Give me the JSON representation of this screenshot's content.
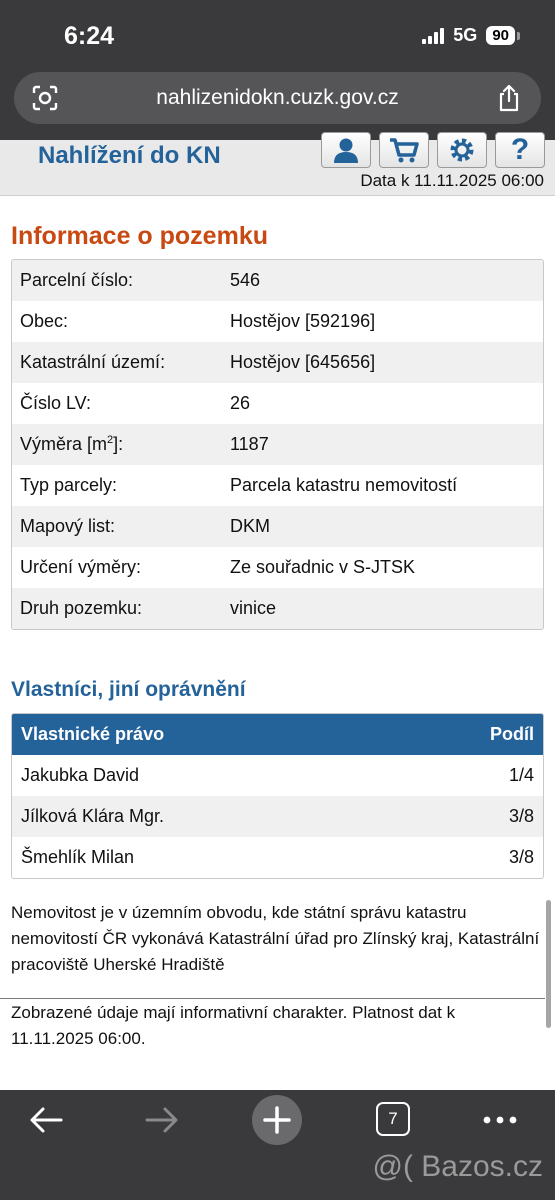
{
  "status_bar": {
    "time": "6:24",
    "network": "5G",
    "battery": "90"
  },
  "browser": {
    "url": "nahlizenidokn.cuzk.gov.cz",
    "open_tabs": "7"
  },
  "header": {
    "site_title": "Nahlížení do KN",
    "date_label": "Data k 11.11.2025 06:00",
    "icons": [
      "user-icon",
      "cart-icon",
      "gear-icon",
      "help-icon"
    ]
  },
  "parcel_info": {
    "heading": "Informace o pozemku",
    "rows": [
      {
        "label": "Parcelní číslo:",
        "value": "546"
      },
      {
        "label": "Obec:",
        "value": "Hostějov [592196]"
      },
      {
        "label": "Katastrální území:",
        "value": "Hostějov [645656]"
      },
      {
        "label": "Číslo LV:",
        "value": "26"
      },
      {
        "label": "Výměra [m",
        "label_sup": "2",
        "label_end": "]:",
        "value": "1187"
      },
      {
        "label": "Typ parcely:",
        "value": "Parcela katastru nemovitostí"
      },
      {
        "label": "Mapový list:",
        "value": "DKM"
      },
      {
        "label": "Určení výměry:",
        "value": "Ze souřadnic v S-JTSK"
      },
      {
        "label": "Druh pozemku:",
        "value": "vinice"
      }
    ]
  },
  "owners": {
    "heading": "Vlastníci, jiní oprávnění",
    "columns": {
      "right": "Vlastnické právo",
      "share": "Podíl"
    },
    "rows": [
      {
        "name": "Jakubka David",
        "share": "1/4"
      },
      {
        "name": "Jílková Klára Mgr.",
        "share": "3/8"
      },
      {
        "name": "Šmehlík Milan",
        "share": "3/8"
      }
    ]
  },
  "note": "Nemovitost je v územním obvodu, kde státní správu katastru nemovitostí ČR vykonává Katastrální úřad pro Zlínský kraj, Katastrální pracoviště Uherské Hradiště",
  "disclaimer": "Zobrazené údaje mají informativní charakter. Platnost dat k 11.11.2025 06:00.",
  "watermark": "@( Bazos.cz",
  "colors": {
    "brand_blue": "#24629a",
    "heading_orange": "#c84a12",
    "browser_chrome": "#3a3a3c"
  }
}
